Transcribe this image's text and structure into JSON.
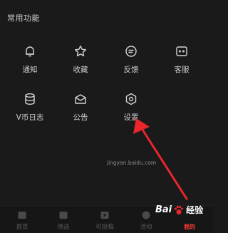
{
  "section": {
    "title": "常用功能"
  },
  "functions": [
    {
      "label": "通知",
      "icon": "bell-icon"
    },
    {
      "label": "收藏",
      "icon": "star-icon"
    },
    {
      "label": "反馈",
      "icon": "feedback-icon"
    },
    {
      "label": "客服",
      "icon": "customer-service-icon"
    },
    {
      "label": "V币日志",
      "icon": "coin-log-icon"
    },
    {
      "label": "公告",
      "icon": "announcement-icon"
    },
    {
      "label": "设置",
      "icon": "settings-icon"
    }
  ],
  "tabbar": {
    "tabs": [
      {
        "label": "首页",
        "icon": "home-tab-icon"
      },
      {
        "label": "筛选",
        "icon": "filter-tab-icon"
      },
      {
        "label": "可投稿",
        "icon": "video-tab-icon"
      },
      {
        "label": "活动",
        "icon": "activity-tab-icon"
      }
    ]
  },
  "watermark": {
    "url": "jingyan.baidu.com",
    "logo_text": "Bai",
    "logo_text2": "经验",
    "logo_sub": "我的"
  },
  "colors": {
    "background": "#1a1a1a",
    "text": "#cccccc",
    "arrow": "#e8262c"
  }
}
